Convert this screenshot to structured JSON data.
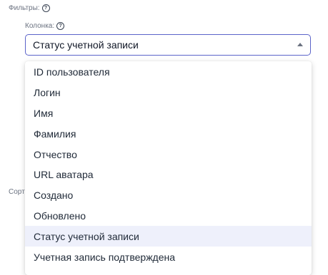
{
  "filters": {
    "label": "Фильтры:"
  },
  "column": {
    "label": "Колонка:"
  },
  "select": {
    "value": "Статус учетной записи"
  },
  "sort": {
    "label": "Сорт"
  },
  "dropdown": {
    "options": [
      {
        "label": "ID пользователя"
      },
      {
        "label": "Логин"
      },
      {
        "label": "Имя"
      },
      {
        "label": "Фамилия"
      },
      {
        "label": "Отчество"
      },
      {
        "label": "URL аватара"
      },
      {
        "label": "Создано"
      },
      {
        "label": "Обновлено"
      },
      {
        "label": "Статус учетной записи"
      },
      {
        "label": "Учетная запись подтверждена"
      }
    ],
    "selected_index": 8
  },
  "colors": {
    "accent": "#5b63c9",
    "selected_bg": "#eef0fb"
  }
}
